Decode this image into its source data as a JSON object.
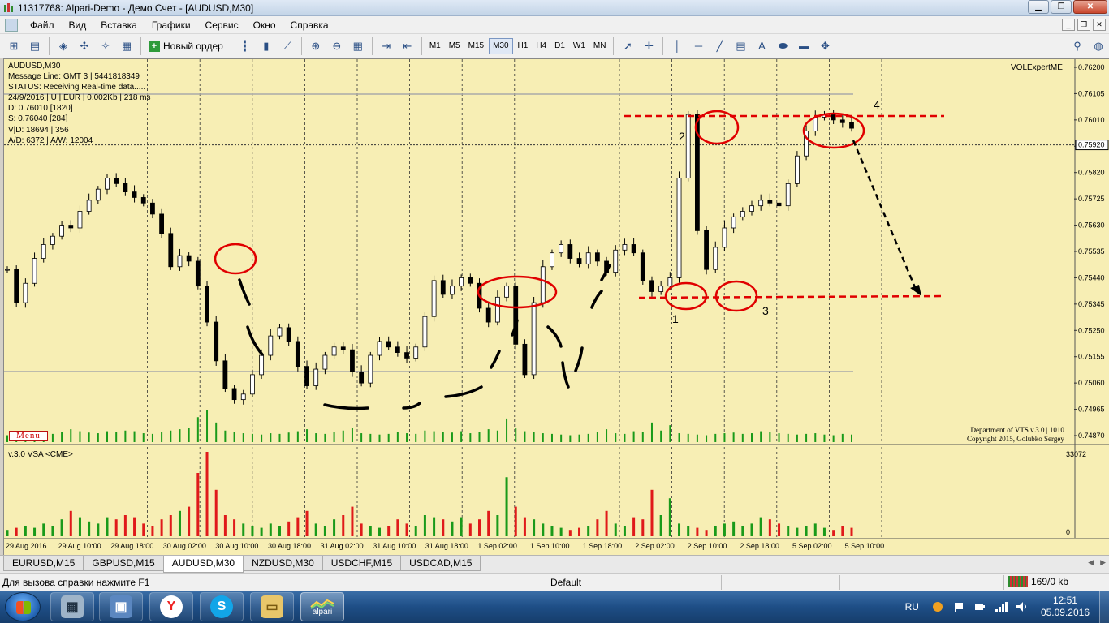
{
  "window": {
    "title": "11317768: Alpari-Demo - Демо Счет - [AUDUSD,M30]"
  },
  "menu": {
    "items": [
      "Файл",
      "Вид",
      "Вставка",
      "Графики",
      "Сервис",
      "Окно",
      "Справка"
    ]
  },
  "toolbar": {
    "new_order_label": "Новый ордер",
    "timeframes": [
      "M1",
      "M5",
      "M15",
      "M30",
      "H1",
      "H4",
      "D1",
      "W1",
      "MN"
    ],
    "active_timeframe": "M30"
  },
  "chart": {
    "symbol_label": "AUDUSD,M30",
    "info_lines": [
      "Message Line: GMT 3  |  5441818349",
      "STATUS:  Receiving Real-time data.....",
      "24/9/2016 | U | EUR | 0.002Kb | 218 ms",
      "D: 0.76010  [1820]",
      "S: 0.76040  [284]",
      "V|D: 18694 | 356",
      "A/D: 6372 | A/W: 12004"
    ],
    "expert_label": "VOLExpertME",
    "menu_button": "Menu",
    "credits": [
      "Department of VTS  v.3.0 | 1010",
      "Copyright 2015, Golubko Sergey"
    ],
    "subwindow_label": "v.3.0 VSA <CME>",
    "subwindow_max": "33072",
    "subwindow_zero": "0",
    "current_price": "0.75920",
    "annotations": [
      "1",
      "2",
      "3",
      "4"
    ],
    "colors": {
      "background": "#f7eeb4",
      "candle": "#000000",
      "volume_up": "#1a9a1a",
      "volume_down": "#e01a1a",
      "annotation": "#e00000"
    }
  },
  "chart_data": {
    "type": "candlestick",
    "price_axis_labels": [
      "0.76200",
      "0.76105",
      "0.76010",
      "0.75915",
      "0.75820",
      "0.75725",
      "0.75630",
      "0.75535",
      "0.75440",
      "0.75345",
      "0.75250",
      "0.75155",
      "0.75060",
      "0.74965",
      "0.74870"
    ],
    "ylim": [
      0.7487,
      0.762
    ],
    "time_axis_labels": [
      "29 Aug 2016",
      "29 Aug 10:00",
      "29 Aug 18:00",
      "30 Aug 02:00",
      "30 Aug 10:00",
      "30 Aug 18:00",
      "31 Aug 02:00",
      "31 Aug 10:00",
      "31 Aug 18:00",
      "1 Sep 02:00",
      "1 Sep 10:00",
      "1 Sep 18:00",
      "2 Sep 02:00",
      "2 Sep 10:00",
      "2 Sep 18:00",
      "5 Sep 02:00",
      "5 Sep 10:00"
    ],
    "series": [
      {
        "values": [
          0.7547,
          0.7535,
          0.7542,
          0.7551,
          0.7556,
          0.7559,
          0.7563,
          0.7562,
          0.7568,
          0.7572,
          0.7576,
          0.758,
          0.7578,
          0.7575,
          0.7573,
          0.7571,
          0.7567,
          0.756,
          0.7548,
          0.7552,
          0.755,
          0.7541,
          0.7528,
          0.7514,
          0.7504,
          0.75,
          0.7502,
          0.7509,
          0.7516,
          0.7523,
          0.7526,
          0.7521,
          0.7512,
          0.7505,
          0.7511,
          0.7516,
          0.7519,
          0.7518,
          0.751,
          0.7506,
          0.7516,
          0.7521,
          0.7519,
          0.7517,
          0.7515,
          0.7519,
          0.753,
          0.7543,
          0.7538,
          0.7541,
          0.7544,
          0.7542,
          0.7533,
          0.7528,
          0.7537,
          0.7541,
          0.752,
          0.7509,
          0.7535,
          0.7548,
          0.7553,
          0.7556,
          0.7551,
          0.7549,
          0.7553,
          0.755,
          0.7546,
          0.7554,
          0.7556,
          0.7553,
          0.7543,
          0.7539,
          0.7541,
          0.7544,
          0.758,
          0.7603,
          0.7561,
          0.7547,
          0.7555,
          0.7562,
          0.7566,
          0.7568,
          0.757,
          0.7572,
          0.7571,
          0.757,
          0.7578,
          0.7588,
          0.7597,
          0.7602,
          0.7603,
          0.7601,
          0.76,
          0.7598
        ]
      }
    ],
    "volume_values": [
      3,
      4,
      5,
      4,
      6,
      5,
      8,
      12,
      9,
      7,
      6,
      9,
      8,
      10,
      9,
      6,
      5,
      8,
      10,
      12,
      14,
      30,
      40,
      22,
      10,
      8,
      6,
      5,
      4,
      6,
      5,
      7,
      9,
      12,
      6,
      5,
      8,
      10,
      14,
      6,
      5,
      4,
      5,
      8,
      6,
      5,
      10,
      9,
      8,
      7,
      9,
      6,
      8,
      12,
      10,
      28,
      14,
      9,
      8,
      6,
      5,
      4,
      3,
      4,
      5,
      8,
      12,
      6,
      5,
      9,
      8,
      22,
      10,
      18,
      6,
      5,
      4,
      3,
      5,
      6,
      7,
      5,
      6,
      9,
      8,
      6,
      5,
      4,
      5,
      6,
      4,
      3,
      5,
      4
    ]
  },
  "tabs": [
    "EURUSD,M15",
    "GBPUSD,M15",
    "AUDUSD,M30",
    "NZDUSD,M30",
    "USDCHF,M15",
    "USDCAD,M15"
  ],
  "active_tab": "AUDUSD,M30",
  "status": {
    "help_text": "Для вызова справки нажмите F1",
    "profile": "Default",
    "traffic": "169/0 kb"
  },
  "taskbar": {
    "alpari_label": "alpari",
    "lang": "RU",
    "time": "12:51",
    "date": "05.09.2016"
  }
}
